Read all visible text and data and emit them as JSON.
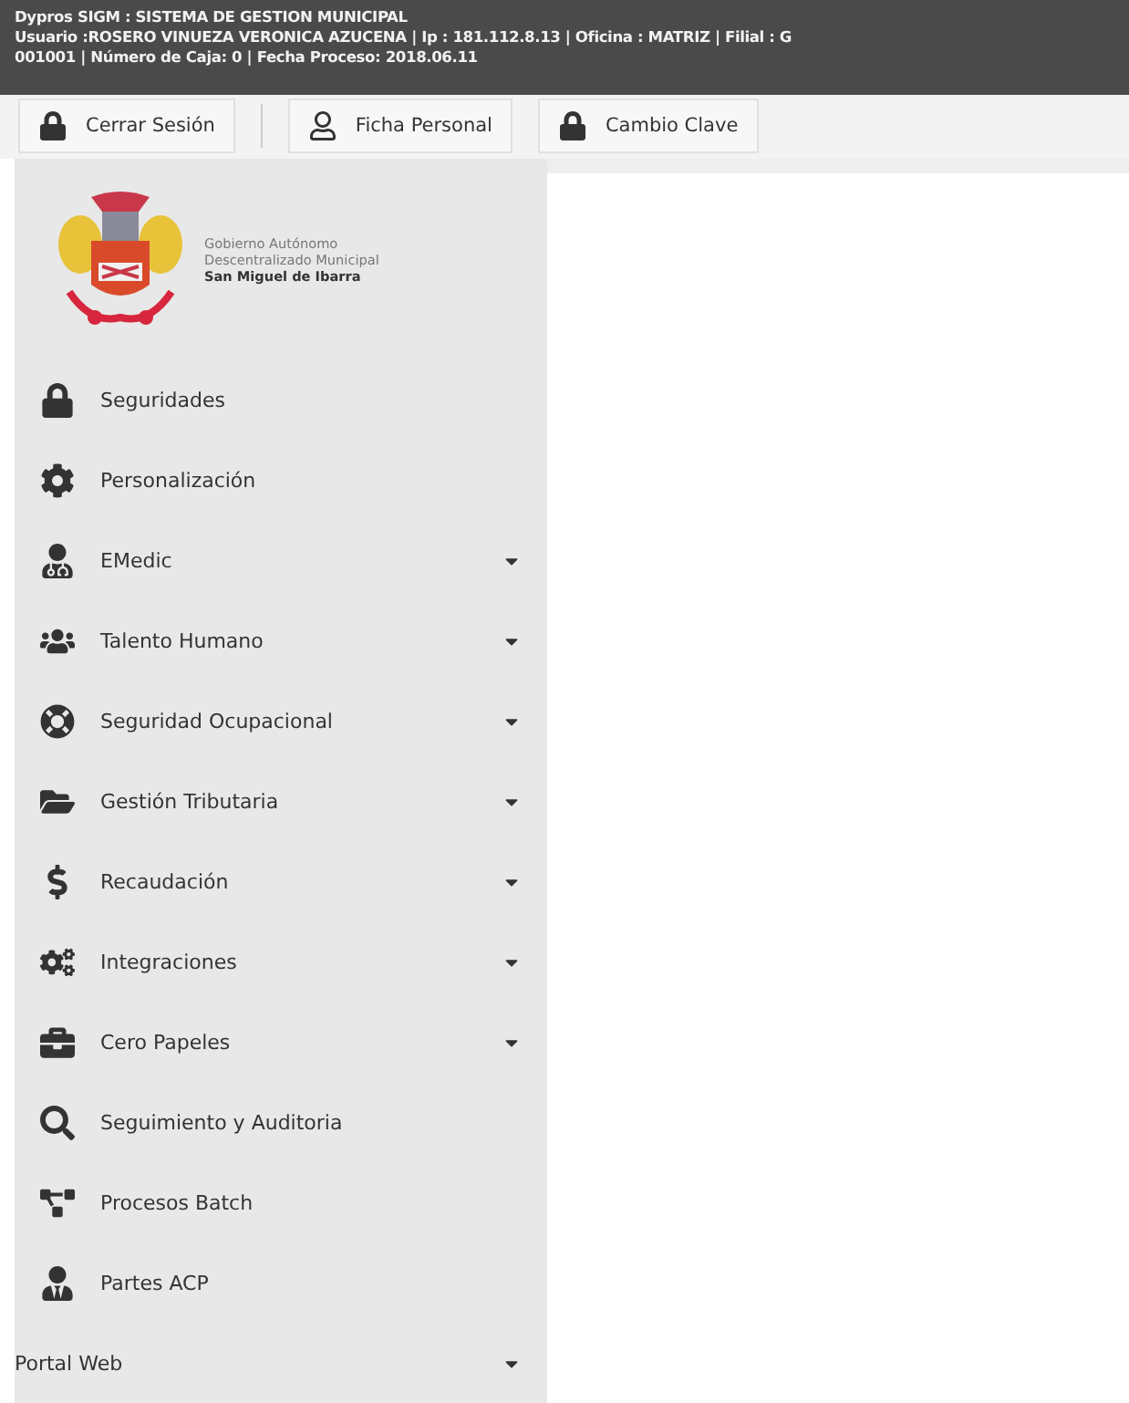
{
  "header": {
    "lines": [
      "Dypros SIGM : SISTEMA DE GESTION MUNICIPAL",
      "Usuario :ROSERO VINUEZA VERONICA AZUCENA | Ip : 181.112.8.13 | Oficina : MATRIZ | Filial : G",
      "001001 | Número de Caja: 0 | Fecha Proceso: 2018.06.11"
    ]
  },
  "toolbar": {
    "buttons": [
      "Cerrar Sesión",
      "Ficha Personal",
      "Cambio Clave"
    ]
  },
  "sidebar": {
    "logo": {
      "lines": [
        "Gobierno Autónomo",
        "Descentralizado Municipal",
        "San Miguel de Ibarra"
      ]
    },
    "items": [
      {
        "label": "Seguridades",
        "has_submenu": false
      },
      {
        "label": "Personalización",
        "has_submenu": false
      },
      {
        "label": "EMedic",
        "has_submenu": true
      },
      {
        "label": "Talento Humano",
        "has_submenu": true
      },
      {
        "label": "Seguridad Ocupacional",
        "has_submenu": true
      },
      {
        "label": "Gestión Tributaria",
        "has_submenu": true
      },
      {
        "label": "Recaudación",
        "has_submenu": true
      },
      {
        "label": "Integraciones",
        "has_submenu": true
      },
      {
        "label": "Cero Papeles",
        "has_submenu": true
      },
      {
        "label": "Seguimiento y Auditoria",
        "has_submenu": false
      },
      {
        "label": "Procesos Batch",
        "has_submenu": false
      },
      {
        "label": "Partes ACP",
        "has_submenu": false
      },
      {
        "label": "Portal Web",
        "has_submenu": true
      }
    ]
  }
}
